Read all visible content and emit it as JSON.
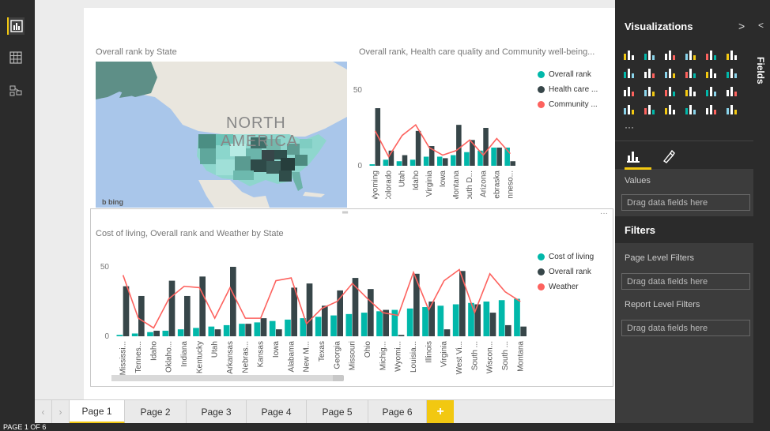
{
  "report": {
    "status_text": "PAGE 1 OF 6",
    "tabs": [
      {
        "label": "Page 1",
        "active": true
      },
      {
        "label": "Page 2"
      },
      {
        "label": "Page 3"
      },
      {
        "label": "Page 4"
      },
      {
        "label": "Page 5"
      },
      {
        "label": "Page 6"
      }
    ],
    "add_tab": "+",
    "nav_left": "‹",
    "nav_right": "›",
    "resize_grip": "═",
    "more_options": "···"
  },
  "panes": {
    "visualizations_title": "Visualizations",
    "collapse_chevron": ">",
    "fields_label": "Fields",
    "fields_chevron": "<",
    "more_visuals": "···",
    "values_label": "Values",
    "values_drop": "Drag data fields here",
    "filters_title": "Filters",
    "page_filters_label": "Page Level Filters",
    "page_filters_drop": "Drag data fields here",
    "report_filters_label": "Report Level Filters",
    "report_filters_drop": "Drag data fields here",
    "viz_icons": [
      "stacked-bar-icon",
      "stacked-column-icon",
      "clustered-bar-icon",
      "clustered-column-icon",
      "100-bar-icon",
      "100-column-icon",
      "line-icon",
      "area-icon",
      "stacked-area-icon",
      "line-column-icon",
      "ribbon-icon",
      "scatter-icon",
      "pie-icon",
      "treemap-icon",
      "map-icon",
      "table-icon",
      "matrix-icon",
      "filled-map-icon",
      "funnel-icon",
      "gauge-icon",
      "multi-row-card-icon",
      "card-icon",
      "slicer-icon",
      "donut-icon"
    ]
  },
  "colors": {
    "teal": "#01b8aa",
    "dark": "#374649",
    "red": "#fd625e",
    "accent": "#f2c811"
  },
  "map_visual": {
    "title": "Overall rank by State",
    "map_label_1": "NORTH",
    "map_label_2": "AMERICA",
    "logo": "b bing"
  },
  "chart_data": [
    {
      "type": "bar",
      "title": "Overall rank, Health care quality and Community well-being...",
      "categories": [
        "Wyoming",
        "Colorado",
        "Utah",
        "Idaho",
        "Virginia",
        "Iowa",
        "Montana",
        "South D...",
        "Arizona",
        "Nebraska",
        "Minneso..."
      ],
      "ylim": [
        0,
        50
      ],
      "yticks": [
        0,
        50
      ],
      "series": [
        {
          "name": "Overall rank",
          "kind": "bar",
          "color": "#01b8aa",
          "values": [
            1,
            4,
            3,
            4,
            6,
            6,
            7,
            9,
            10,
            12,
            12
          ]
        },
        {
          "name": "Health care ...",
          "kind": "bar",
          "color": "#374649",
          "values": [
            38,
            10,
            7,
            23,
            13,
            5,
            27,
            17,
            25,
            12,
            3
          ]
        },
        {
          "name": "Community ...",
          "kind": "line",
          "color": "#fd625e",
          "values": [
            23,
            6,
            20,
            27,
            12,
            7,
            10,
            17,
            7,
            18,
            8
          ]
        }
      ],
      "legend_position": "top-right"
    },
    {
      "type": "bar",
      "title": "Cost of living, Overall rank and Weather by State",
      "categories": [
        "Mississi...",
        "Tennes...",
        "Idaho",
        "Oklaho...",
        "Indiana",
        "Kentucky",
        "Utah",
        "Arkansas",
        "Nebras...",
        "Kansas",
        "Iowa",
        "Alabama",
        "New M...",
        "Texas",
        "Georgia",
        "Missouri",
        "Ohio",
        "Michig...",
        "Wyomi...",
        "Louisia...",
        "Illinois",
        "Virginia",
        "West Vi...",
        "South ...",
        "Wiscon...",
        "South ...",
        "Montana"
      ],
      "ylim": [
        0,
        50
      ],
      "yticks": [
        0,
        50
      ],
      "series": [
        {
          "name": "Cost of living",
          "kind": "bar",
          "color": "#01b8aa",
          "values": [
            1,
            2,
            3,
            4,
            5,
            6,
            7,
            8,
            9,
            10,
            11,
            12,
            13,
            14,
            15,
            16,
            17,
            18,
            19,
            20,
            21,
            22,
            23,
            24,
            25,
            26,
            27
          ]
        },
        {
          "name": "Overall rank",
          "kind": "bar",
          "color": "#374649",
          "values": [
            36,
            29,
            4,
            40,
            29,
            43,
            5,
            50,
            9,
            13,
            5,
            35,
            38,
            22,
            33,
            42,
            34,
            19,
            1,
            45,
            25,
            5,
            47,
            23,
            17,
            8,
            7
          ]
        },
        {
          "name": "Weather",
          "kind": "line",
          "color": "#fd625e",
          "values": [
            44,
            13,
            6,
            27,
            36,
            35,
            13,
            35,
            13,
            13,
            40,
            42,
            9,
            20,
            25,
            38,
            27,
            17,
            15,
            46,
            19,
            40,
            48,
            17,
            45,
            32,
            25
          ]
        }
      ],
      "legend_position": "top-right"
    }
  ]
}
